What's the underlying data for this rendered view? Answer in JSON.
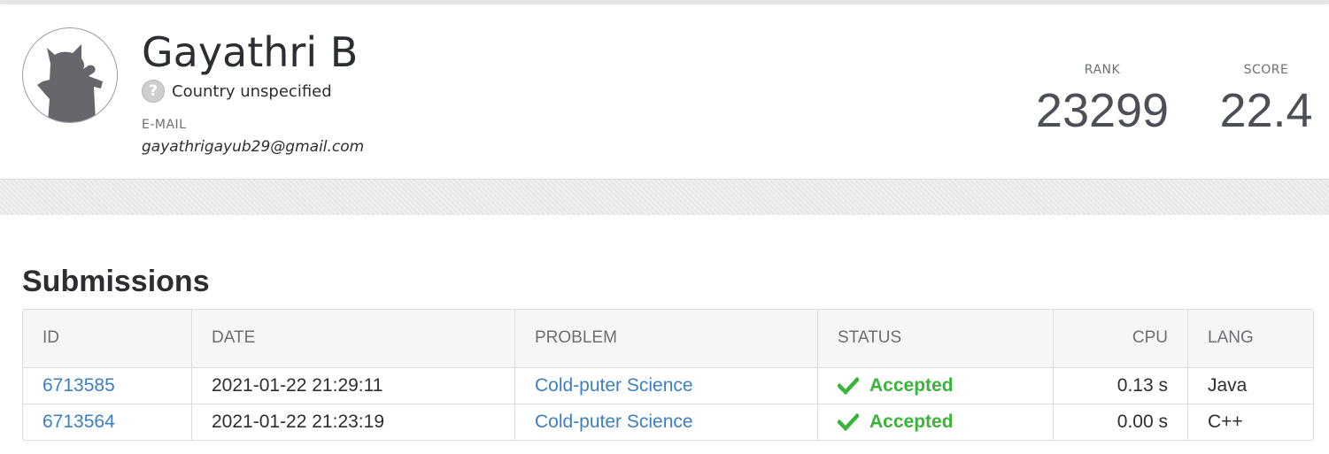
{
  "profile": {
    "name": "Gayathri B",
    "country": "Country unspecified",
    "email_label": "E-MAIL",
    "email": "gayathrigayub29@gmail.com",
    "avatar_icon": "default-cat-avatar-icon",
    "country_icon": "unknown-flag-icon"
  },
  "stats": {
    "rank_label": "RANK",
    "rank_value": "23299",
    "score_label": "SCORE",
    "score_value": "22.4"
  },
  "submissions": {
    "title": "Submissions",
    "columns": [
      "ID",
      "DATE",
      "PROBLEM",
      "STATUS",
      "CPU",
      "LANG"
    ],
    "rows": [
      {
        "id": "6713585",
        "date": "2021-01-22 21:29:11",
        "problem": "Cold-puter Science",
        "status": "Accepted",
        "cpu": "0.13 s",
        "lang": "Java"
      },
      {
        "id": "6713564",
        "date": "2021-01-22 21:23:19",
        "problem": "Cold-puter Science",
        "status": "Accepted",
        "cpu": "0.00 s",
        "lang": "C++"
      }
    ]
  },
  "colors": {
    "link": "#3d7fc1",
    "accepted": "#3bb33b",
    "text": "#2b2f33",
    "muted": "#6b7075"
  }
}
